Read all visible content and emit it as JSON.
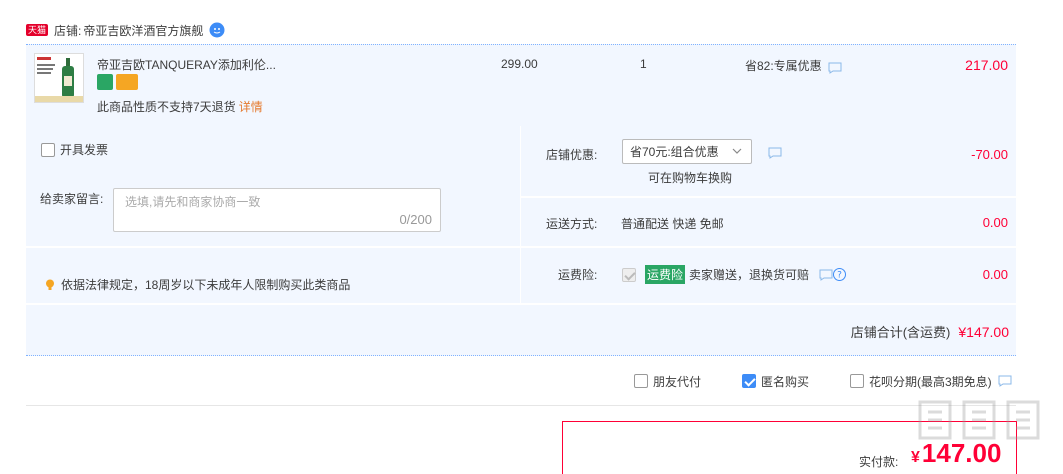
{
  "shop": {
    "badge": "天猫",
    "label": "店铺:",
    "name": "帝亚吉欧洋酒官方旗舰"
  },
  "item": {
    "title": "帝亚吉欧TANQUERAY添加利伦...",
    "price": "299.00",
    "qty": "1",
    "discount": "省82:专属优惠",
    "subtotal": "217.00",
    "no_return": "此商品性质不支持7天退货",
    "details_link": "详情"
  },
  "invoice": {
    "label": "开具发票"
  },
  "message": {
    "label": "给卖家留言:",
    "placeholder": "选填,请先和商家协商一致",
    "count": "0/200"
  },
  "law_notice": "依据法律规定，18周岁以下未成年人限制购买此类商品",
  "store_discount": {
    "label": "店铺优惠:",
    "selected": "省70元:组合优惠",
    "hint": "可在购物车换购",
    "amount": "-70.00"
  },
  "shipping": {
    "label": "运送方式:",
    "method": "普通配送 快递 免邮",
    "amount": "0.00"
  },
  "insurance": {
    "label": "运费险:",
    "tag": "运费险",
    "text": "卖家赠送，退换货可赔",
    "amount": "0.00"
  },
  "shop_total": {
    "label": "店铺合计(含运费)",
    "value": "¥147.00"
  },
  "options": {
    "friend_pay": "朋友代付",
    "anonymous": "匿名购买",
    "huabei": "花呗分期(最高3期免息)"
  },
  "payment": {
    "label": "实付款:",
    "currency": "¥",
    "value": "147.00"
  },
  "colors": {
    "accent_red": "#ff0036",
    "panel_bg": "#f2f7ff",
    "checkbox_blue": "#3d8cf7",
    "insurance_green": "#2aa664"
  }
}
